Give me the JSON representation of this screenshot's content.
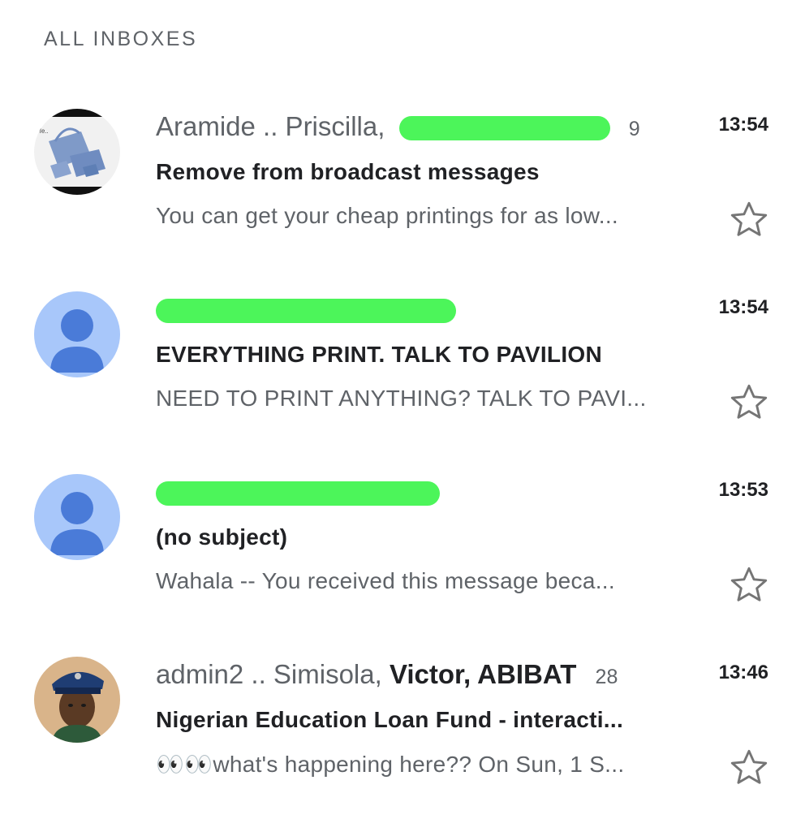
{
  "header": {
    "title": "ALL INBOXES"
  },
  "emails": [
    {
      "avatar": "bag-product-photo",
      "sender_prefix": "Aramide .. Priscilla,",
      "sender_bold": "",
      "count": "9",
      "time": "13:54",
      "subject": "Remove from broadcast messages",
      "snippet": "You can get your cheap printings for as low...",
      "redacted": true
    },
    {
      "avatar": "default-person-icon",
      "sender_prefix": "",
      "sender_bold": "",
      "count": "",
      "time": "13:54",
      "subject": "EVERYTHING PRINT. TALK TO PAVILION",
      "snippet": "NEED TO PRINT ANYTHING? TALK TO PAVI...",
      "redacted": true
    },
    {
      "avatar": "default-person-icon",
      "sender_prefix": "",
      "sender_bold": "",
      "count": "",
      "time": "13:53",
      "subject": "(no subject)",
      "snippet": "Wahala -- You received this message beca...",
      "redacted": true
    },
    {
      "avatar": "officer-portrait",
      "sender_prefix": "admin2 .. Simisola,",
      "sender_bold": "Victor, ABIBAT",
      "count": "28",
      "time": "13:46",
      "subject": "Nigerian Education Loan Fund - interacti...",
      "snippet": "👀👀what's happening here?? On Sun, 1 S...",
      "redacted": false
    }
  ],
  "colors": {
    "redaction": "#4cf55a",
    "default_avatar_bg": "#a8c7fa",
    "default_avatar_fg": "#4a7bd8"
  }
}
